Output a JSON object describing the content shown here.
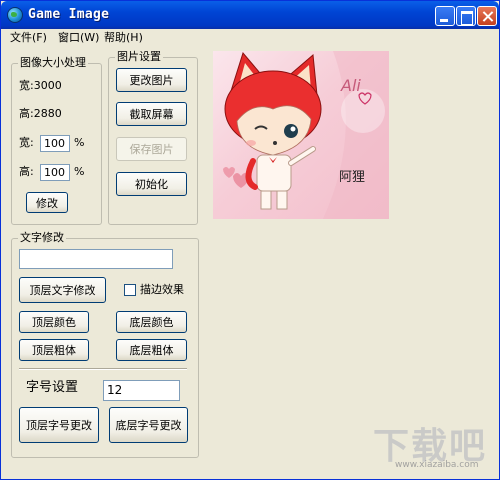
{
  "window": {
    "title": "Game Image"
  },
  "menu": {
    "items": [
      "文件(F)",
      "窗口(W)",
      "帮助(H)"
    ]
  },
  "image_size": {
    "label": "图像大小处理",
    "width_info": "宽:3000",
    "height_info": "高:2880",
    "width_label": "宽:",
    "width_value": "100",
    "height_label": "高:",
    "height_value": "100",
    "percent": "%",
    "modify_button": "修改"
  },
  "picture_settings": {
    "label": "图片设置",
    "change_button": "更改图片",
    "capture_button": "截取屏幕",
    "save_button": "保存图片",
    "init_button": "初始化"
  },
  "preview": {
    "caption": "阿狸",
    "logo_text": "Ali"
  },
  "text_edit": {
    "label": "文字修改",
    "text_value": "",
    "top_text_button": "顶层文字修改",
    "outline_label": "描边效果",
    "outline_checked": false,
    "top_color_button": "顶层颜色",
    "bottom_color_button": "底层颜色",
    "top_bold_button": "顶层粗体",
    "bottom_bold_button": "底层粗体",
    "font_size_label": "字号设置",
    "font_size_value": "12",
    "top_font_button": "顶层字号更改",
    "bottom_font_button": "底层字号更改"
  },
  "watermark": {
    "text": "下载吧",
    "url": "www.xiazaiba.com"
  }
}
